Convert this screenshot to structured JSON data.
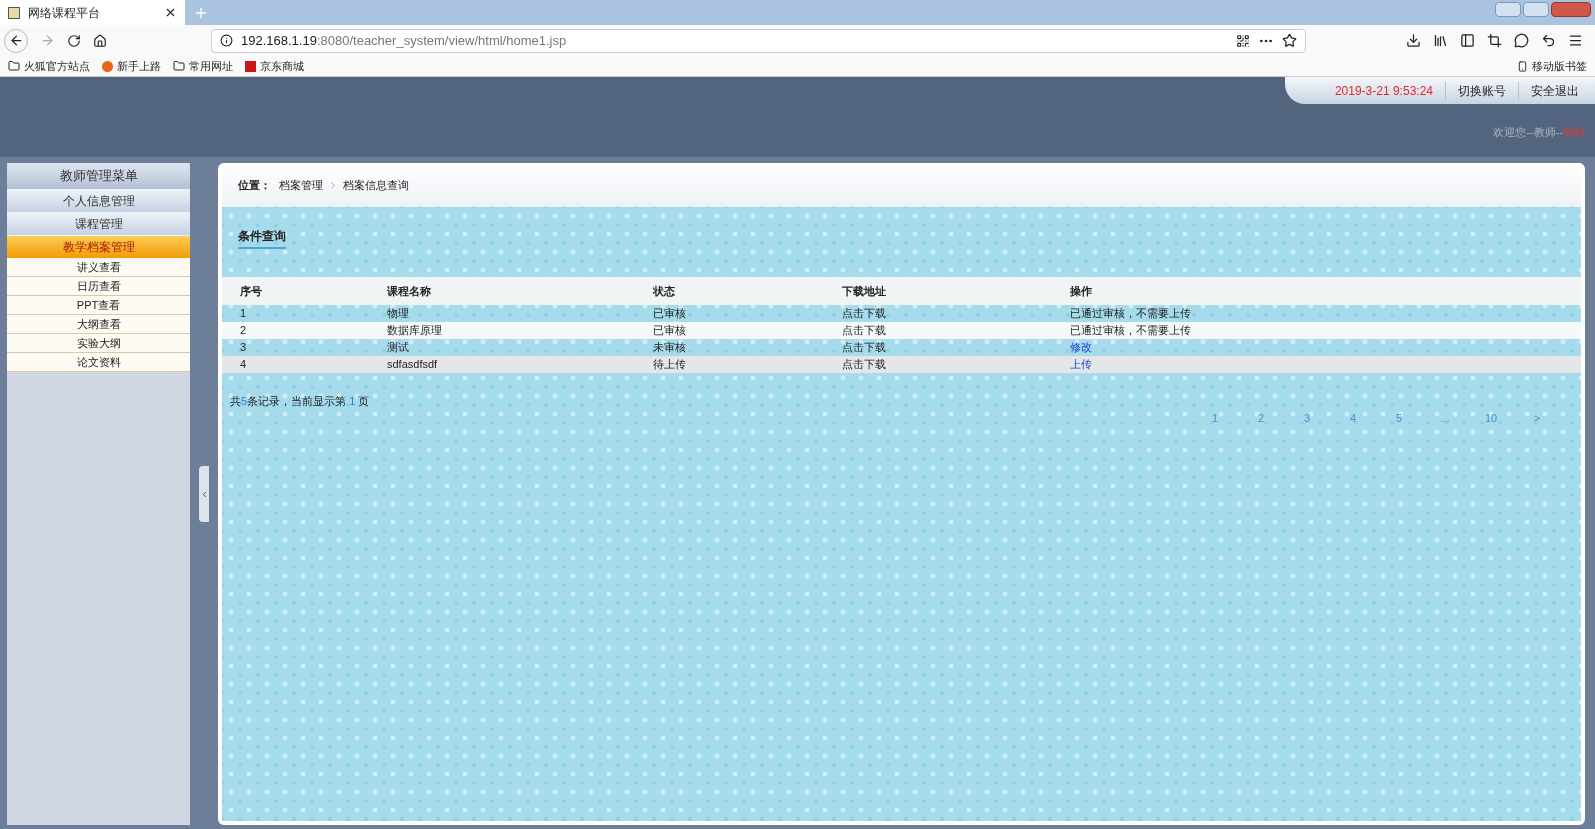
{
  "browser": {
    "tab_title": "网络课程平台",
    "url_host": "192.168.1.19",
    "url_rest": ":8080/teacher_system/view/html/home1.jsp",
    "bookmarks": [
      "火狐官方站点",
      "新手上路",
      "常用网址",
      "京东商城"
    ],
    "mobile_bookmarks": "移动版书签"
  },
  "header": {
    "datetime": "2019-3-21 9:53:24",
    "links": [
      "切换账号",
      "安全退出"
    ],
    "welcome": "欢迎您--教师--",
    "user": "孙利"
  },
  "sidebar": {
    "title": "教师管理菜单",
    "items": [
      {
        "label": "个人信息管理",
        "selected": false
      },
      {
        "label": "课程管理",
        "selected": false
      },
      {
        "label": "教学档案管理",
        "selected": true,
        "children": [
          "讲义查看",
          "日历查看",
          "PPT查看",
          "大纲查看",
          "实验大纲",
          "论文资料"
        ]
      }
    ]
  },
  "breadcrumb": {
    "label": "位置：",
    "path": [
      "档案管理",
      "档案信息查询"
    ]
  },
  "section_title": "条件查询",
  "table": {
    "columns": [
      "序号",
      "课程名称",
      "状态",
      "下载地址",
      "操作"
    ],
    "rows": [
      {
        "cells": [
          "1",
          "物理",
          "已审核",
          "点击下载"
        ],
        "action": "已通过审核，不需要上传",
        "kind": "text"
      },
      {
        "cells": [
          "2",
          "数据库原理",
          "已审核",
          "点击下载"
        ],
        "action": "已通过审核，不需要上传",
        "kind": "text"
      },
      {
        "cells": [
          "3",
          "测试",
          "未审核",
          "点击下载"
        ],
        "action": "修改",
        "kind": "link"
      },
      {
        "cells": [
          "4",
          "sdfasdfsdf",
          "待上传",
          "点击下载"
        ],
        "action": "上传",
        "kind": "link"
      }
    ]
  },
  "summary": {
    "before": "共",
    "count": "5",
    "middle": "条记录，当前显示第",
    "page": "1",
    "after": "页"
  },
  "pagination": [
    "1",
    "2",
    "3",
    "4",
    "5",
    "...",
    "10",
    ">"
  ]
}
